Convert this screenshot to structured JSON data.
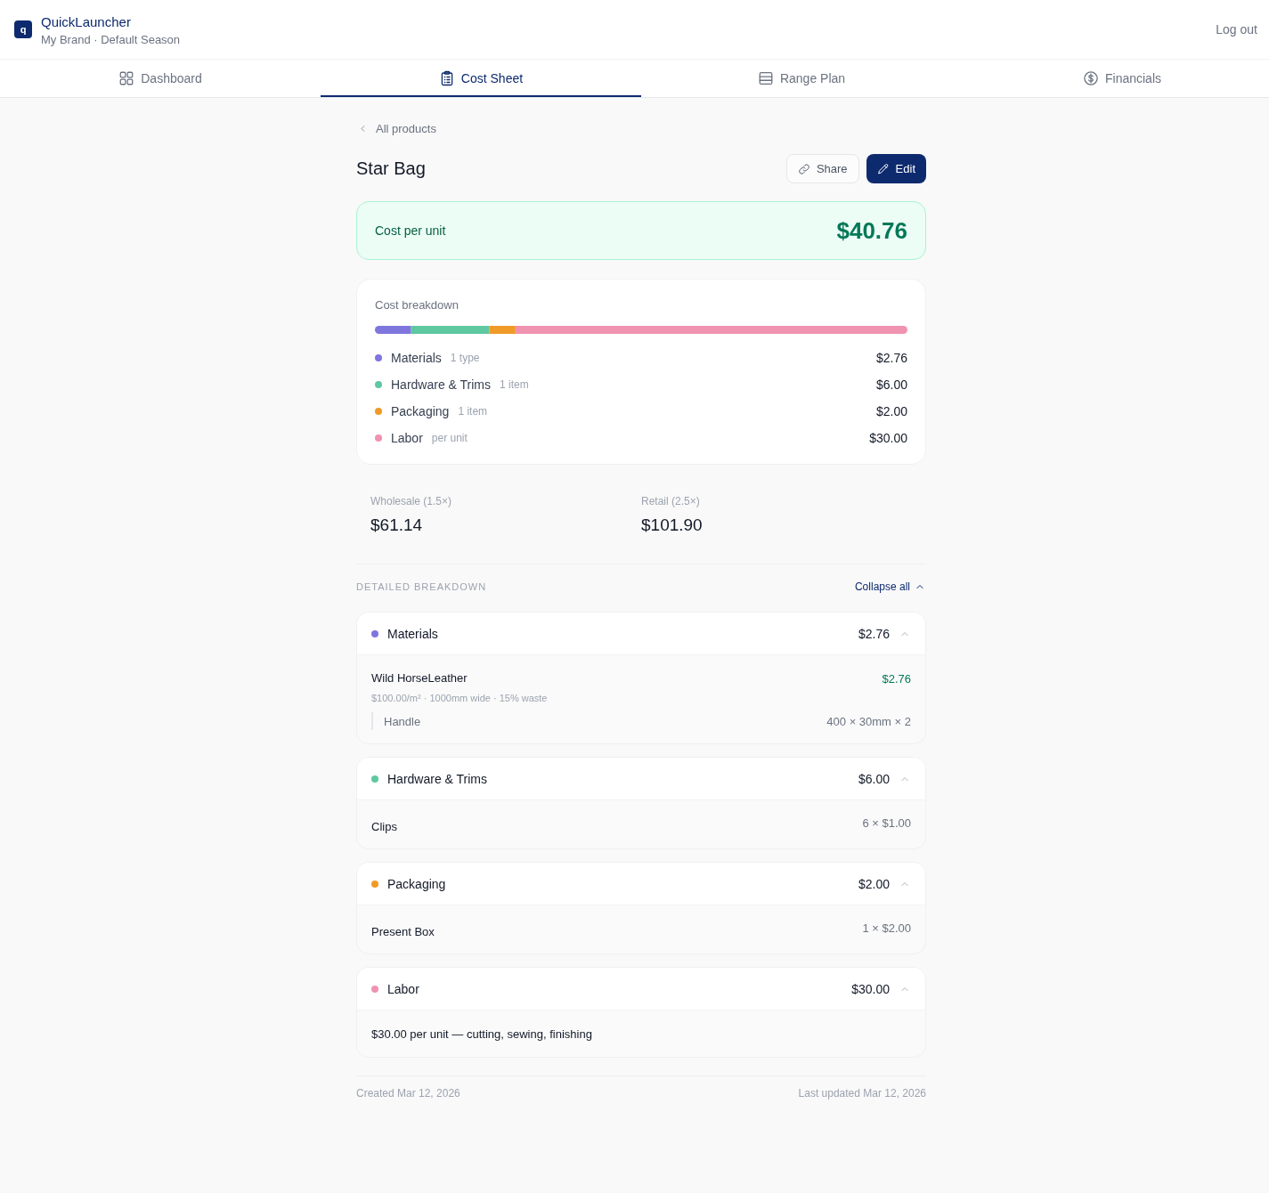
{
  "header": {
    "logo": "q",
    "title": "QuickLauncher",
    "subtitle": "My Brand · Default Season",
    "logout": "Log out"
  },
  "tabs": [
    {
      "label": "Dashboard",
      "selected": false
    },
    {
      "label": "Cost Sheet",
      "selected": true
    },
    {
      "label": "Range Plan",
      "selected": false
    },
    {
      "label": "Financials",
      "selected": false
    }
  ],
  "breadcrumb": "All products",
  "product": {
    "title": "Star Bag",
    "actions": [
      {
        "label": "Share",
        "kind": "secondary"
      },
      {
        "label": "Edit",
        "kind": "primary"
      }
    ]
  },
  "cost_per_unit": {
    "label": "Cost per unit",
    "value": "$40.76"
  },
  "breakdown": {
    "title": "Cost breakdown",
    "items": [
      {
        "name": "Materials",
        "note": "1 type",
        "value": "$2.76",
        "color": "#7f76dd"
      },
      {
        "name": "Hardware & Trims",
        "note": "1 item",
        "value": "$6.00",
        "color": "#5ec8a0"
      },
      {
        "name": "Packaging",
        "note": "1 item",
        "value": "$2.00",
        "color": "#f09b28"
      },
      {
        "name": "Labor",
        "note": "per unit",
        "value": "$30.00",
        "color": "#f093b0"
      }
    ]
  },
  "prices": [
    {
      "label": "Wholesale (1.5×)",
      "value": "$61.14"
    },
    {
      "label": "Retail (2.5×)",
      "value": "$101.90"
    }
  ],
  "detailed": {
    "heading": "DETAILED BREAKDOWN",
    "collapse_label": "Collapse all",
    "sections": [
      {
        "name": "Materials",
        "amount": "$2.76",
        "color": "#7f76dd",
        "expanded": true,
        "items": [
          {
            "kind": "material",
            "name": "Wild HorseLeather",
            "amount": "$2.76",
            "spec": "$100.00/m² · 1000mm wide · 15% waste",
            "usages": [
              {
                "name": "Handle",
                "size": "400 × 30mm × 2"
              }
            ]
          }
        ]
      },
      {
        "name": "Hardware & Trims",
        "amount": "$6.00",
        "color": "#5ec8a0",
        "expanded": true,
        "items": [
          {
            "kind": "component",
            "name": "Clips",
            "quantity": "6 × $1.00"
          }
        ]
      },
      {
        "name": "Packaging",
        "amount": "$2.00",
        "color": "#f09b28",
        "expanded": true,
        "items": [
          {
            "kind": "component",
            "name": "Present Box",
            "quantity": "1 × $2.00"
          }
        ]
      },
      {
        "name": "Labor",
        "amount": "$30.00",
        "color": "#f093b0",
        "expanded": true,
        "items": [
          {
            "kind": "note",
            "text": "$30.00 per unit — cutting, sewing, finishing"
          }
        ]
      }
    ]
  },
  "footer": {
    "created": "Created Mar 12, 2026",
    "updated": "Last updated Mar 12, 2026"
  }
}
